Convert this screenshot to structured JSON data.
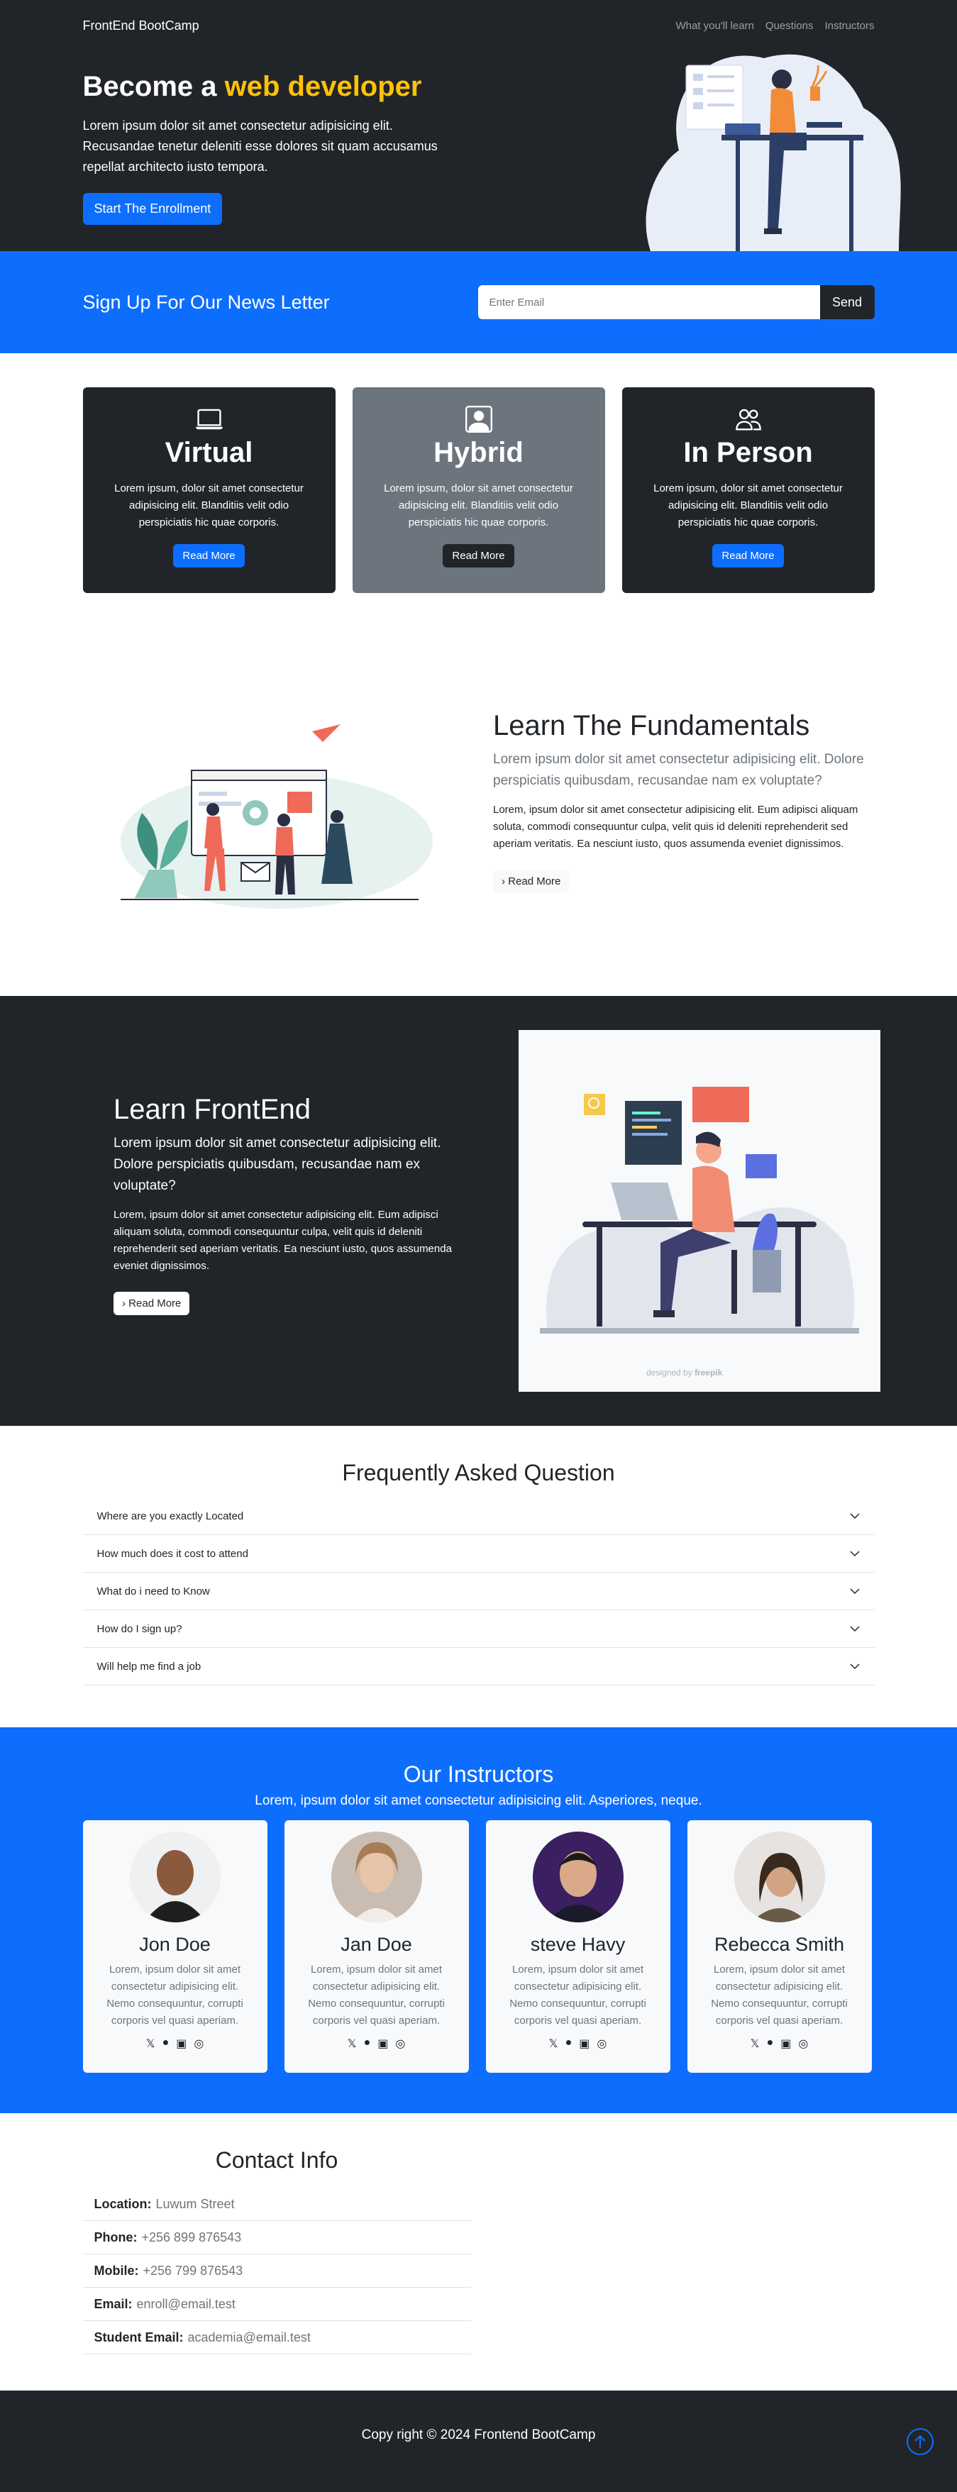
{
  "navbar": {
    "brand": "FrontEnd BootCamp",
    "links": [
      "What you'll learn",
      "Questions",
      "Instructors"
    ]
  },
  "hero": {
    "title_prefix": "Become a ",
    "title_highlight": "web developer",
    "text": "Lorem ipsum dolor sit amet consectetur adipisicing elit. Recusandae tenetur deleniti esse dolores sit quam accusamus repellat architecto iusto tempora.",
    "cta": "Start The Enrollment"
  },
  "newsletter": {
    "heading": "Sign Up For Our News Letter",
    "placeholder": "Enter Email",
    "button": "Send"
  },
  "cards": [
    {
      "icon": "laptop-icon",
      "title": "Virtual",
      "text": "Lorem ipsum, dolor sit amet consectetur adipisicing elit. Blanditiis velit odio perspiciatis hic quae corporis.",
      "button": "Read More"
    },
    {
      "icon": "person-badge-icon",
      "title": "Hybrid",
      "text": "Lorem ipsum, dolor sit amet consectetur adipisicing elit. Blanditiis velit odio perspiciatis hic quae corporis.",
      "button": "Read More"
    },
    {
      "icon": "people-icon",
      "title": "In Person",
      "text": "Lorem ipsum, dolor sit amet consectetur adipisicing elit. Blanditiis velit odio perspiciatis hic quae corporis.",
      "button": "Read More"
    }
  ],
  "fundamentals": {
    "title": "Learn The Fundamentals",
    "lead": "Lorem ipsum dolor sit amet consectetur adipisicing elit. Dolore perspiciatis quibusdam, recusandae nam ex voluptate?",
    "body": "Lorem, ipsum dolor sit amet consectetur adipisicing elit. Eum adipisci aliquam soluta, commodi consequuntur culpa, velit quis id deleniti reprehenderit sed aperiam veritatis. Ea nesciunt iusto, quos assumenda eveniet dignissimos.",
    "button": "Read More"
  },
  "frontend": {
    "title": "Learn FrontEnd",
    "lead": "Lorem ipsum dolor sit amet consectetur adipisicing elit. Dolore perspiciatis quibusdam, recusandae nam ex voluptate?",
    "body": "Lorem, ipsum dolor sit amet consectetur adipisicing elit. Eum adipisci aliquam soluta, commodi consequuntur culpa, velit quis id deleniti reprehenderit sed aperiam veritatis. Ea nesciunt iusto, quos assumenda eveniet dignissimos.",
    "button": "Read More",
    "image_credit": "designed by",
    "image_credit_brand": "freepik"
  },
  "faq": {
    "title": "Frequently Asked Question",
    "items": [
      "Where are you exactly Located",
      "How much does it cost to attend",
      "What do i need to Know",
      "How do I sign up?",
      "Will help me find a job"
    ]
  },
  "instructors": {
    "title": "Our Instructors",
    "subtitle": "Lorem, ipsum dolor sit amet consectetur adipisicing elit. Asperiores, neque.",
    "people": [
      {
        "name": "Jon Doe",
        "bio": "Lorem, ipsum dolor sit amet consectetur adipisicing elit. Nemo consequuntur, corrupti corporis vel quasi aperiam."
      },
      {
        "name": "Jan Doe",
        "bio": "Lorem, ipsum dolor sit amet consectetur adipisicing elit. Nemo consequuntur, corrupti corporis vel quasi aperiam."
      },
      {
        "name": "steve Havy",
        "bio": "Lorem, ipsum dolor sit amet consectetur adipisicing elit. Nemo consequuntur, corrupti corporis vel quasi aperiam."
      },
      {
        "name": "Rebecca Smith",
        "bio": "Lorem, ipsum dolor sit amet consectetur adipisicing elit. Nemo consequuntur, corrupti corporis vel quasi aperiam."
      }
    ],
    "social_icons": [
      "twitter-icon",
      "facebook-icon",
      "linkedin-icon",
      "instagram-icon"
    ]
  },
  "contact": {
    "title": "Contact Info",
    "rows": [
      {
        "label": "Location:",
        "value": "Luwum Street"
      },
      {
        "label": "Phone:",
        "value": "+256 899 876543"
      },
      {
        "label": "Mobile:",
        "value": "+256 799 876543"
      },
      {
        "label": "Email:",
        "value": "enroll@email.test"
      },
      {
        "label": "Student Email:",
        "value": "academia@email.test"
      }
    ]
  },
  "footer": {
    "text": "Copy right © 2024 Frontend BootCamp"
  },
  "colors": {
    "dark": "#212529",
    "primary": "#0d6efd",
    "warning": "#ffc107",
    "secondary": "#6c757d"
  }
}
